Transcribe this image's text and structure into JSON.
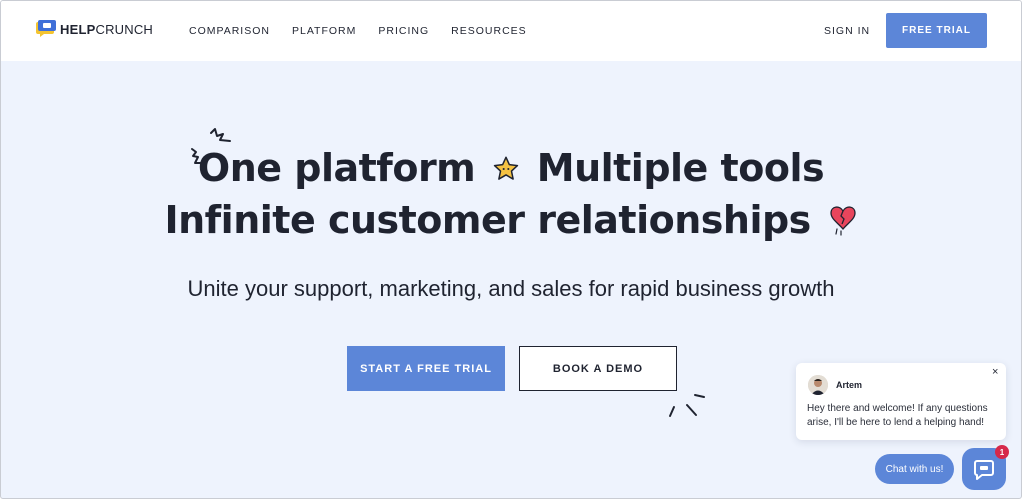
{
  "header": {
    "logo": {
      "bold": "HELP",
      "regular": "CRUNCH"
    },
    "nav": [
      {
        "label": "COMPARISON"
      },
      {
        "label": "PLATFORM"
      },
      {
        "label": "PRICING"
      },
      {
        "label": "RESOURCES"
      }
    ],
    "sign_in": "SIGN IN",
    "free_trial": "FREE TRIAL"
  },
  "hero": {
    "line1_a": "One platform",
    "line1_b": "Multiple tools",
    "line2": "Infinite customer relationships",
    "subheadline": "Unite your support, marketing, and sales for rapid business growth",
    "cta_primary": "START A FREE TRIAL",
    "cta_secondary": "BOOK A DEMO"
  },
  "chat": {
    "agent_name": "Artem",
    "message": "Hey there and welcome! If any questions arise, I'll be here to lend a helping hand!",
    "close_symbol": "×",
    "pill_label": "Chat with us!",
    "badge_count": "1"
  },
  "colors": {
    "accent": "#5c86d8",
    "hero_bg": "#eef3fd",
    "badge": "#d6294a",
    "text": "#1f2330"
  },
  "icons": [
    "helpcrunch-logo-icon",
    "star-icon",
    "broken-heart-icon",
    "chat-icon",
    "close-icon"
  ]
}
